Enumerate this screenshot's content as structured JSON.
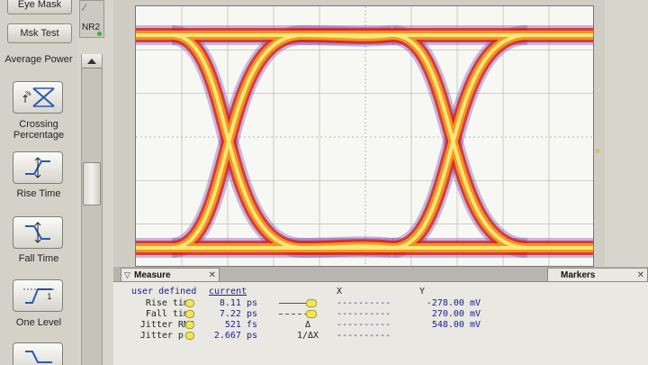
{
  "left_toolbar": {
    "eye_mask_button": "Eye Mask",
    "mask_test_button": "Msk Test",
    "section_label": "Average Power",
    "tools": [
      {
        "label": "Crossing Percentage",
        "icon": "crossing-percentage-icon"
      },
      {
        "label": "Rise Time",
        "icon": "rise-time-icon"
      },
      {
        "label": "Fall Time",
        "icon": "fall-time-icon"
      },
      {
        "label": "One Level",
        "icon": "one-level-icon"
      },
      {
        "label": "",
        "icon": "zero-level-icon"
      }
    ]
  },
  "side_controls": {
    "nr2_label": "NR2"
  },
  "tabs": {
    "measure": "Measure",
    "markers": "Markers"
  },
  "measure": {
    "header_user_defined": "user defined",
    "header_current": "current",
    "rows": [
      {
        "name": "Rise time",
        "value": "8.11 ps"
      },
      {
        "name": "Fall time",
        "value": "7.22 ps"
      },
      {
        "name": "Jitter RMS",
        "value": "521 fs"
      },
      {
        "name": "Jitter p-p",
        "value": "2.667 ps"
      }
    ]
  },
  "markers": {
    "header_x": "X",
    "header_y": "Y",
    "rows": [
      {
        "sym": "",
        "x": "----------",
        "y": "-278.00 mV"
      },
      {
        "sym": "",
        "x": "----------",
        "y": "270.00 mV"
      },
      {
        "sym": "Δ",
        "x": "----------",
        "y": "548.00 mV"
      },
      {
        "sym": "1/ΔX",
        "x": "----------",
        "y": ""
      }
    ]
  },
  "colors": {
    "trace_core": "#ffe97a",
    "trace_mid": "#f29a1f",
    "trace_edge": "#d9262a",
    "trace_halo": "#6b3fb0"
  }
}
